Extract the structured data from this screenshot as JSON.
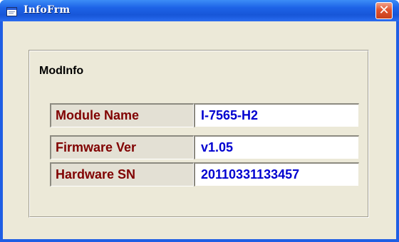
{
  "window": {
    "title": "InfoFrm",
    "close_symbol": "✕",
    "colors": {
      "titlebar": "#1e64e7",
      "client": "#ece9d8",
      "close_button": "#e0532e"
    }
  },
  "group": {
    "label": "ModInfo",
    "rows": [
      {
        "label": "Module Name",
        "value": "I-7565-H2"
      },
      {
        "label": "Firmware Ver",
        "value": "v1.05"
      },
      {
        "label": "Hardware SN",
        "value": "20110331133457"
      }
    ],
    "colors": {
      "label_text": "#800000",
      "value_text": "#0000d0"
    }
  },
  "icons": {
    "app": "app-window-icon",
    "close": "close-icon"
  }
}
